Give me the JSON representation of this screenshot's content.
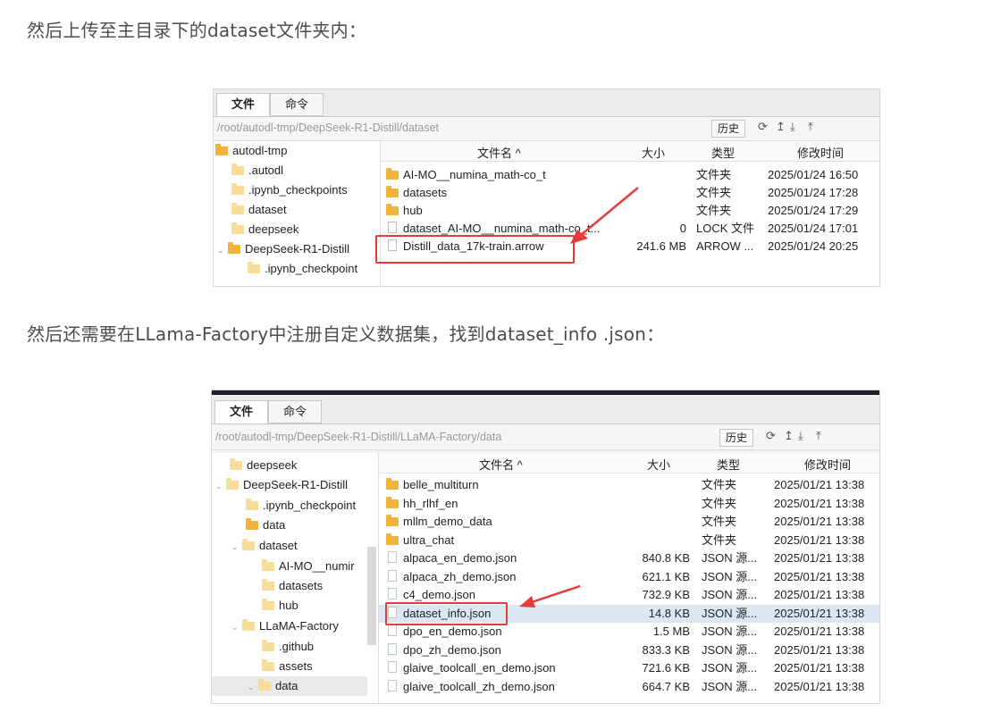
{
  "paragraphs": {
    "p1": "然后上传至主目录下的dataset文件夹内：",
    "p2": "然后还需要在LLama-Factory中注册自定义数据集，找到dataset_info .json："
  },
  "window1": {
    "tabs": [
      "文件",
      "命令"
    ],
    "path": "/root/autodl-tmp/DeepSeek-R1-Distill/dataset",
    "history_label": "历史",
    "toolbar_icons": [
      "refresh-icon",
      "up-icon",
      "download-icon",
      "upload-icon"
    ],
    "tree": [
      {
        "label": "autodl-tmp",
        "expanded": true
      },
      {
        "label": ".autodl"
      },
      {
        "label": ".ipynb_checkpoints"
      },
      {
        "label": "dataset"
      },
      {
        "label": "deepseek"
      },
      {
        "label": "DeepSeek-R1-Distill",
        "expanded": true
      },
      {
        "label": ".ipynb_checkpoint"
      }
    ],
    "columns": {
      "name": "文件名 ^",
      "size": "大小",
      "type": "类型",
      "mtime": "修改时间"
    },
    "rows": [
      {
        "name": "AI-MO__numina_math-co_t",
        "size": "",
        "type": "文件夹",
        "mtime": "2025/01/24 16:50",
        "kind": "folder"
      },
      {
        "name": "datasets",
        "size": "",
        "type": "文件夹",
        "mtime": "2025/01/24 17:28",
        "kind": "folder"
      },
      {
        "name": "hub",
        "size": "",
        "type": "文件夹",
        "mtime": "2025/01/24 17:29",
        "kind": "folder"
      },
      {
        "name": "dataset_AI-MO__numina_math-co_t...",
        "size": "0",
        "type": "LOCK 文件",
        "mtime": "2025/01/24 17:01",
        "kind": "file"
      },
      {
        "name": "Distill_data_17k-train.arrow",
        "size": "241.6 MB",
        "type": "ARROW ...",
        "mtime": "2025/01/24 20:25",
        "kind": "file"
      }
    ]
  },
  "window2": {
    "tabs": [
      "文件",
      "命令"
    ],
    "path": "/root/autodl-tmp/DeepSeek-R1-Distill/LLaMA-Factory/data",
    "history_label": "历史",
    "toolbar_icons": [
      "refresh-icon",
      "up-icon",
      "download-icon",
      "upload-icon"
    ],
    "tree": [
      {
        "label": "deepseek"
      },
      {
        "label": "DeepSeek-R1-Distill",
        "expanded": true
      },
      {
        "label": ".ipynb_checkpoint"
      },
      {
        "label": "data"
      },
      {
        "label": "dataset",
        "expanded": true
      },
      {
        "label": "AI-MO__numir"
      },
      {
        "label": "datasets"
      },
      {
        "label": "hub"
      },
      {
        "label": "LLaMA-Factory",
        "expanded": true
      },
      {
        "label": ".github"
      },
      {
        "label": "assets"
      },
      {
        "label": "data",
        "expanded": true
      }
    ],
    "columns": {
      "name": "文件名 ^",
      "size": "大小",
      "type": "类型",
      "mtime": "修改时间"
    },
    "rows": [
      {
        "name": "belle_multiturn",
        "size": "",
        "type": "文件夹",
        "mtime": "2025/01/21 13:38",
        "kind": "folder"
      },
      {
        "name": "hh_rlhf_en",
        "size": "",
        "type": "文件夹",
        "mtime": "2025/01/21 13:38",
        "kind": "folder"
      },
      {
        "name": "mllm_demo_data",
        "size": "",
        "type": "文件夹",
        "mtime": "2025/01/21 13:38",
        "kind": "folder"
      },
      {
        "name": "ultra_chat",
        "size": "",
        "type": "文件夹",
        "mtime": "2025/01/21 13:38",
        "kind": "folder"
      },
      {
        "name": "alpaca_en_demo.json",
        "size": "840.8 KB",
        "type": "JSON 源...",
        "mtime": "2025/01/21 13:38",
        "kind": "file"
      },
      {
        "name": "alpaca_zh_demo.json",
        "size": "621.1 KB",
        "type": "JSON 源...",
        "mtime": "2025/01/21 13:38",
        "kind": "file"
      },
      {
        "name": "c4_demo.json",
        "size": "732.9 KB",
        "type": "JSON 源...",
        "mtime": "2025/01/21 13:38",
        "kind": "file"
      },
      {
        "name": "dataset_info.json",
        "size": "14.8 KB",
        "type": "JSON 源...",
        "mtime": "2025/01/21 13:38",
        "kind": "file",
        "selected": true
      },
      {
        "name": "dpo_en_demo.json",
        "size": "1.5 MB",
        "type": "JSON 源...",
        "mtime": "2025/01/21 13:38",
        "kind": "file"
      },
      {
        "name": "dpo_zh_demo.json",
        "size": "833.3 KB",
        "type": "JSON 源...",
        "mtime": "2025/01/21 13:38",
        "kind": "file"
      },
      {
        "name": "glaive_toolcall_en_demo.json",
        "size": "721.6 KB",
        "type": "JSON 源...",
        "mtime": "2025/01/21 13:38",
        "kind": "file"
      },
      {
        "name": "glaive_toolcall_zh_demo.json",
        "size": "664.7 KB",
        "type": "JSON 源...",
        "mtime": "2025/01/21 13:38",
        "kind": "file"
      }
    ]
  },
  "colors": {
    "highlight": "#e43b3b",
    "folder": "#f2b33d",
    "selected_row": "#dbe8f3"
  }
}
